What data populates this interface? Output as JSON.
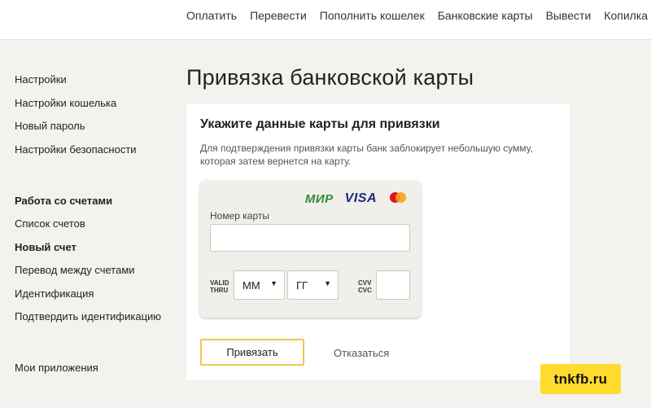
{
  "topnav": {
    "items": [
      "Оплатить",
      "Перевести",
      "Пополнить кошелек",
      "Банковские карты",
      "Вывести",
      "Копилка"
    ]
  },
  "sidebar": {
    "group1": [
      "Настройки",
      "Настройки кошелька",
      "Новый пароль",
      "Настройки безопасности"
    ],
    "group2_title": "Работа со счетами",
    "group2": [
      "Список счетов",
      "Новый счет",
      "Перевод между счетами",
      "Идентификация",
      "Подтвердить идентификацию"
    ],
    "apps": "Мои приложения"
  },
  "main": {
    "title": "Привязка банковской карты",
    "heading": "Укажите данные карты для привязки",
    "note": "Для подтверждения привязки карты банк заблокирует небольшую сумму, которая затем вернется на карту."
  },
  "card_form": {
    "logos": {
      "mir": "МИР",
      "visa": "VISA",
      "mastercard_icon": "mastercard-icon"
    },
    "number_label": "Номер карты",
    "number_value": "",
    "valid_label_1": "VALID",
    "valid_label_2": "THRU",
    "month_value": "ММ",
    "year_value": "ГГ",
    "cvv_label_1": "CVV",
    "cvv_label_2": "CVC",
    "cvv_value": ""
  },
  "actions": {
    "submit": "Привязать",
    "cancel": "Отказаться"
  },
  "watermark": "tnkfb.ru",
  "colors": {
    "accent_border": "#f3c453",
    "watermark_bg": "#ffdb2d",
    "mir_green": "#2f8d3c",
    "visa_blue": "#1a2a7c"
  }
}
